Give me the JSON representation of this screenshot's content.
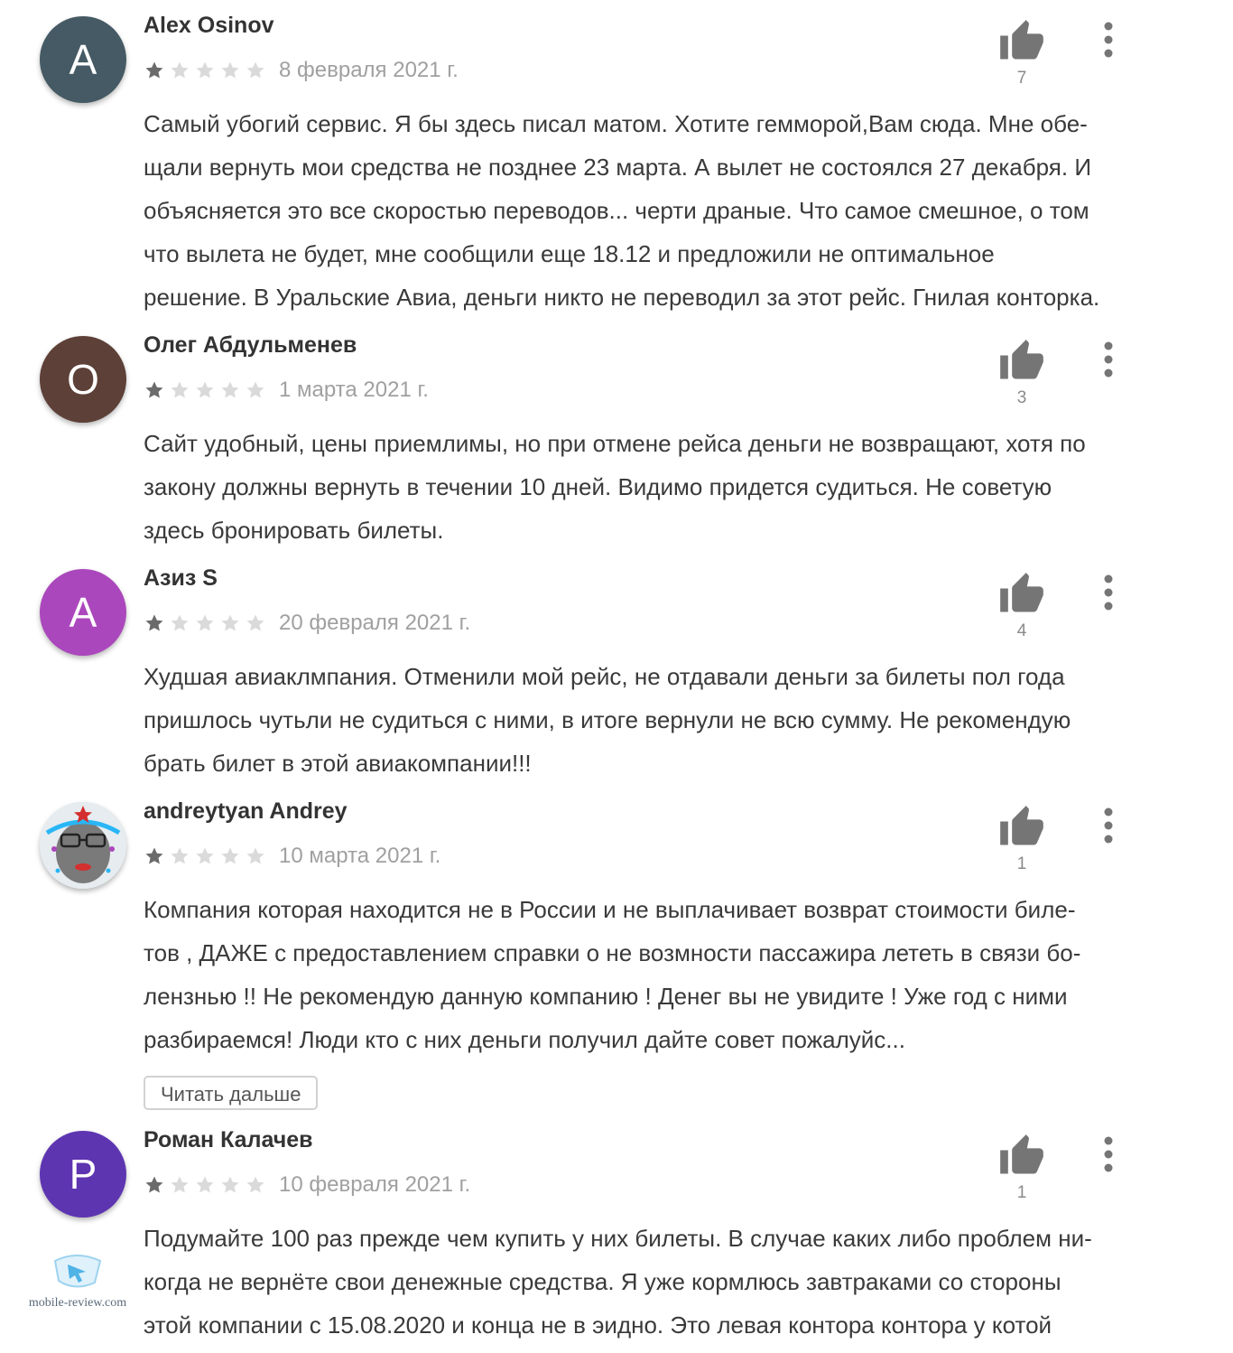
{
  "reviews": [
    {
      "author": "Alex Osinov",
      "avatar_letter": "A",
      "avatar_color": "#455a64",
      "stars": 1,
      "date": "8 февраля 2021 г.",
      "text": "Самый убогий сервис. Я бы здесь писал матом. Хотите геммо­рой,Вам сюда. Мне обе-\nщали вернуть мои средства не позднее 23 марта. А вылет не состоялся 27 декабря. И\nобъясняется это все скоростью переводов... черти драные. Что самое смешное, о том\nчто вылета не будет, мне сообщили еще 18.12 и предложили не оптимальное\nрешение. В Уральские Авиа, деньги никто не переводил за этот рейс. Гнилая конторка.",
      "likes": "7"
    },
    {
      "author": "Олег Абдульменев",
      "avatar_letter": "О",
      "avatar_color": "#5d4037",
      "stars": 1,
      "date": "1 марта 2021 г.",
      "text": "Сайт удобный, цены приемлимы, но при отмене рейса деньги не возвращают, хотя по\nзакону должны вернуть в течении 10 дней. Видимо придется судиться. Не советую\nздесь бронировать билеты.",
      "likes": "3"
    },
    {
      "author": "Азиз S",
      "avatar_letter": "A",
      "avatar_color": "#ab47bc",
      "stars": 1,
      "date": "20 февраля 2021 г.",
      "text": "Худшая авиаклмпания. Отменили мой рейс, не отдавали деньги за билеты пол года\nпришлось чутьли не судиться с ними, в итоге вернули не всю сумму. Не рекомендую\nбрать билет в этой авиакомпании!!!",
      "likes": "4"
    },
    {
      "author": "andreytyan Andrey",
      "avatar_letter": "",
      "avatar_color": "#9e9e9e",
      "stars": 1,
      "date": "10 марта 2021 г.",
      "text": "Компания которая находится не в России и не выплачивает возврат стоимости биле-\nтов , ДАЖЕ с предоставлением справки о не возмности пассажира лететь в связи бо-\nлензнью !! Не рекомендую данную компанию ! Денег вы не увидите ! Уже год с ними\nразбираемся! Люди кто с них деньги получил дайте совет пожалуйс...",
      "likes": "1",
      "read_more": "Читать дальше"
    },
    {
      "author": "Роман Калачев",
      "avatar_letter": "P",
      "avatar_color": "#5e35b1",
      "stars": 1,
      "date": "10 февраля 2021 г.",
      "text": "Подумайте 100 раз прежде чем купить у них билеты. В случае каких либо проблем ни-\nкогда не вернёте свои денежные средства. Я уже кормлюсь завтраками со стороны\nэтой компании с 15.08.2020 и конца не в эидно. Это левая контора контора у котой",
      "likes": "1"
    }
  ],
  "colors": {
    "star_filled": "#6b6b6b",
    "star_empty": "#dadada",
    "icon_gray": "#757575"
  },
  "icons": {
    "thumb": "thumb-up-icon",
    "menu": "more-vert-icon",
    "star": "star-icon"
  },
  "watermark": {
    "text": "mobile-review.com"
  }
}
